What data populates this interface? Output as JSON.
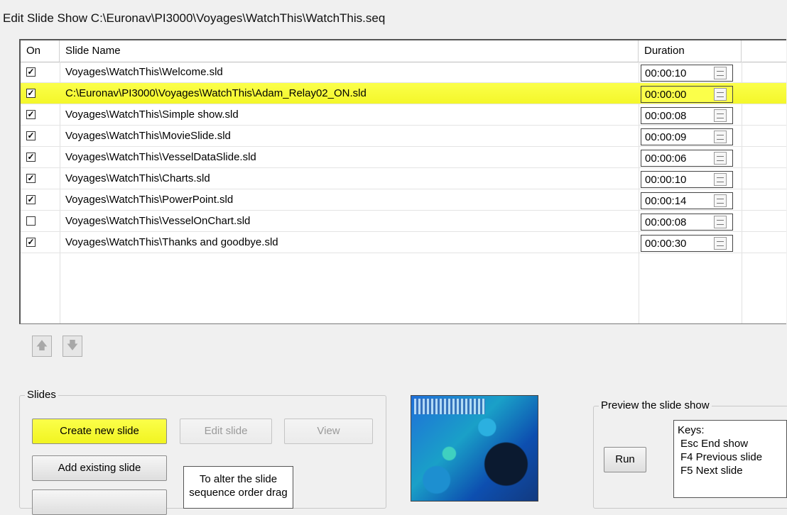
{
  "window": {
    "title": "Edit Slide Show C:\\Euronav\\PI3000\\Voyages\\WatchThis\\WatchThis.seq"
  },
  "list": {
    "headers": {
      "on": "On",
      "name": "Slide Name",
      "duration": "Duration"
    },
    "rows": [
      {
        "checked": "✓",
        "name": "Voyages\\WatchThis\\Welcome.sld",
        "duration": "00:00:10"
      },
      {
        "checked": "✓",
        "name": "C:\\Euronav\\PI3000\\Voyages\\WatchThis\\Adam_Relay02_ON.sld",
        "duration": "00:00:00"
      },
      {
        "checked": "✓",
        "name": "Voyages\\WatchThis\\Simple show.sld",
        "duration": "00:00:08"
      },
      {
        "checked": "✓",
        "name": "Voyages\\WatchThis\\MovieSlide.sld",
        "duration": "00:00:09"
      },
      {
        "checked": "✓",
        "name": "Voyages\\WatchThis\\VesselDataSlide.sld",
        "duration": "00:00:06"
      },
      {
        "checked": "✓",
        "name": "Voyages\\WatchThis\\Charts.sld",
        "duration": "00:00:10"
      },
      {
        "checked": "✓",
        "name": "Voyages\\WatchThis\\PowerPoint.sld",
        "duration": "00:00:14"
      },
      {
        "checked": "",
        "name": "Voyages\\WatchThis\\VesselOnChart.sld",
        "duration": "00:00:08"
      },
      {
        "checked": "✓",
        "name": "Voyages\\WatchThis\\Thanks and goodbye.sld",
        "duration": "00:00:30"
      }
    ]
  },
  "arrows": {
    "up": "🡅",
    "down": "🡇"
  },
  "slides_group": {
    "title": "Slides",
    "create_new": "Create new slide",
    "edit": "Edit slide",
    "view": "View",
    "add_existing": "Add existing slide",
    "info": "To alter the slide sequence order drag"
  },
  "preview_group": {
    "title": "Preview the slide show",
    "run": "Run",
    "keys_title": "Keys:",
    "key1": "Esc End show",
    "key2": "F4 Previous slide",
    "key3": "F5 Next slide"
  },
  "colors": {
    "highlight": "#f4f72a"
  }
}
